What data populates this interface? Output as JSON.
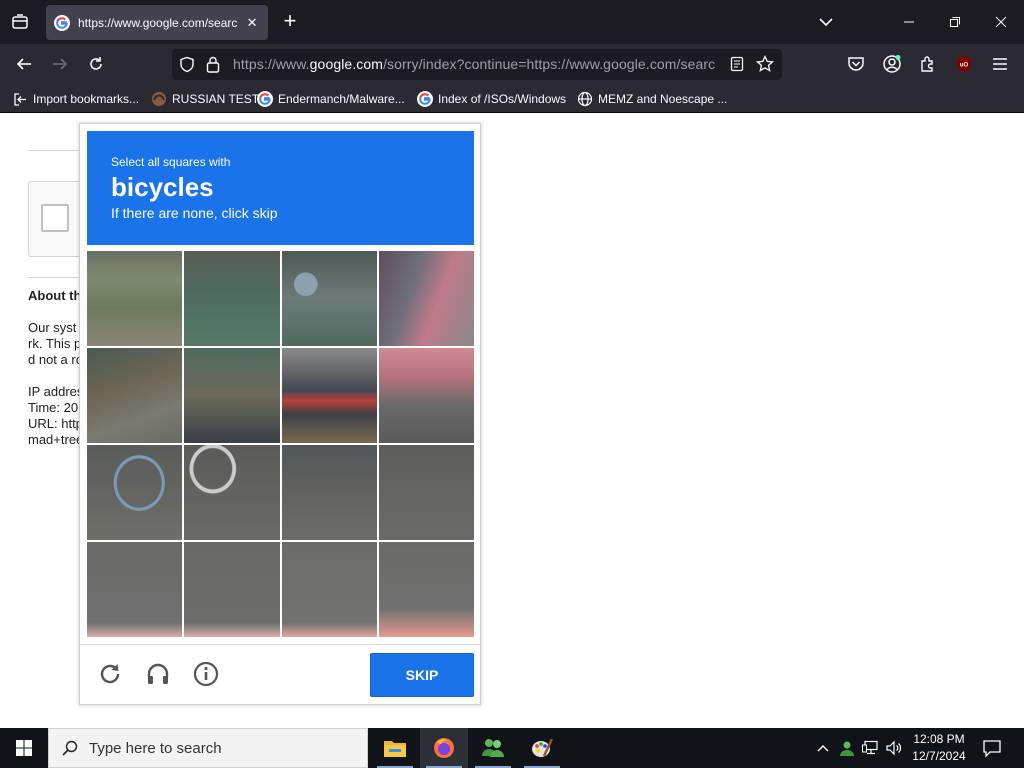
{
  "browser": {
    "tab_title": "https://www.google.com/search",
    "url_prefix": "https://www.",
    "url_domain": "google.com",
    "url_rest": "/sorry/index?continue=https://www.google.com/search",
    "bookmarks": [
      {
        "label": "Import bookmarks...",
        "icon": "import-icon"
      },
      {
        "label": "RUSSIAN TEST",
        "icon": "site-icon"
      },
      {
        "label": "Endermanch/Malware...",
        "icon": "google-icon"
      },
      {
        "label": "Index of /ISOs/Windows",
        "icon": "google-icon"
      },
      {
        "label": "MEMZ and Noescape ...",
        "icon": "globe-icon"
      }
    ]
  },
  "page": {
    "about_title": "About th",
    "about_lines": [
      "Our syst",
      "rk. This p",
      "d not a ro"
    ],
    "info_lines": [
      "IP addres",
      "Time: 20",
      "URL: http",
      "mad+tree"
    ]
  },
  "challenge": {
    "instruction_small": "Select all squares with",
    "target": "bicycles",
    "instruction_sub": "If there are none, click skip",
    "skip_label": "SKIP",
    "footer_icons": [
      "reload-icon",
      "audio-icon",
      "info-icon"
    ]
  },
  "taskbar": {
    "search_placeholder": "Type here to search",
    "time": "12:08 PM",
    "date": "12/7/2024",
    "apps": [
      "file-explorer-icon",
      "firefox-icon",
      "people-icon",
      "paint-icon"
    ]
  }
}
